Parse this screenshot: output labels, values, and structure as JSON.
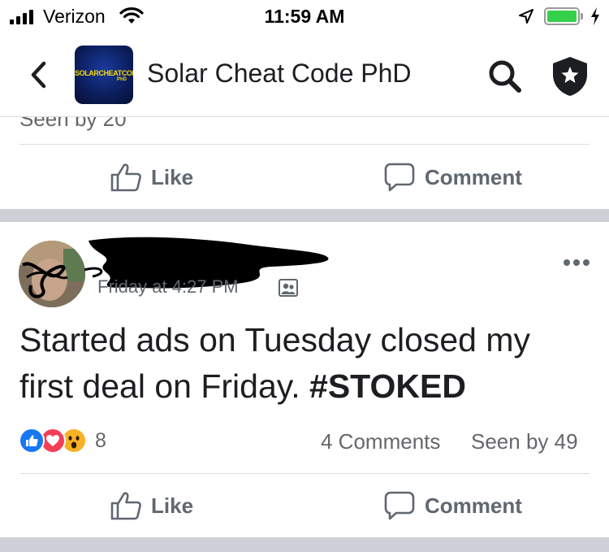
{
  "status_bar": {
    "carrier": "Verizon",
    "time": "11:59 AM",
    "battery_level": 0.9
  },
  "nav": {
    "group_name": "Solar Cheat Code PhD",
    "group_logo_text": "SOLARCHEATCODE",
    "group_logo_sub": "PhD"
  },
  "previous_post": {
    "seen": "Seen by 20",
    "like_label": "Like",
    "comment_label": "Comment"
  },
  "post": {
    "timestamp": "Friday at 4:27 PM",
    "text": "Started ads on Tuesday closed my first deal on Friday.",
    "hashtag": "#STOKED",
    "reaction_count": "8",
    "comments": "4 Comments",
    "seen": "Seen by 49",
    "like_label": "Like",
    "comment_label": "Comment",
    "reaction_icons": [
      "like-icon",
      "love-icon",
      "wow-icon"
    ]
  },
  "colors": {
    "separator": "#cdd0d6",
    "secondary_text": "#65676b",
    "like_blue": "#1877f2",
    "love_red": "#f33e58",
    "wow_yellow": "#f7b125"
  }
}
